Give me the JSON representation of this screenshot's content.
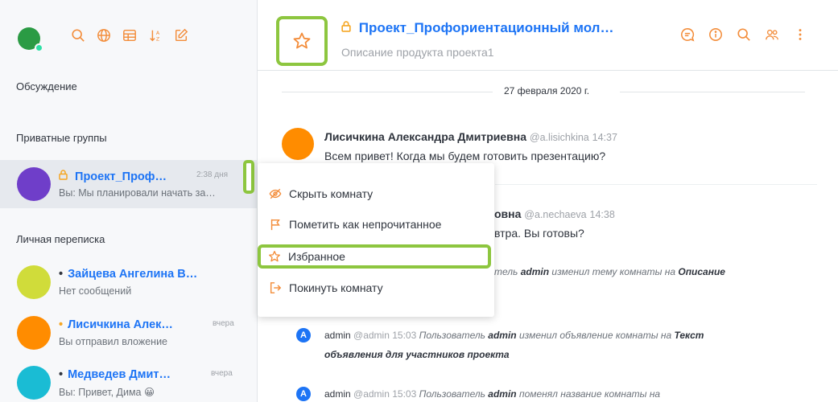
{
  "sidebar": {
    "sections": {
      "discussion": "Обсуждение",
      "private_groups": "Приватные группы",
      "direct": "Личная переписка"
    },
    "icons": [
      "search-icon",
      "globe-icon",
      "table-icon",
      "sort-icon",
      "edit-icon"
    ],
    "rooms": [
      {
        "prefix": "🔒",
        "name": "Проект_Проф…",
        "time": "2:38 дня",
        "last_message": "Вы: Мы планировали начать за…",
        "avatar_color": "#6f3ec9"
      },
      {
        "prefix": "•",
        "name": "Зайцева Ангелина В…",
        "time": "",
        "last_message": "Нет сообщений",
        "avatar_color": "#d0dc3a"
      },
      {
        "prefix": "•",
        "name": "Лисичкина Алек…",
        "time": "вчера",
        "last_message": "Вы отправил вложение",
        "avatar_color": "#ff8c00"
      },
      {
        "prefix": "•",
        "name": "Медведев Дмит…",
        "time": "вчера",
        "last_message": "Вы: Привет, Дима 😀",
        "avatar_color": "#1abcd4"
      }
    ]
  },
  "header": {
    "title": "Проект_Профориентационный мол…",
    "description": "Описание продукта проекта1",
    "icons": [
      "discussion-icon",
      "info-icon",
      "search-icon",
      "members-icon",
      "kebab-icon"
    ]
  },
  "main": {
    "date": "27 февраля 2020 г.",
    "messages": [
      {
        "author": "Лисичкина Александра Дмитриевна",
        "username": "@a.lisichkina",
        "time": "14:37",
        "text": "Всем привет! Когда мы будем готовить презентацию?",
        "avatar_color": "#ff8c00"
      },
      {
        "author_tail": "овна",
        "username": "@a.nechaeva",
        "time": "14:38",
        "text_tail": "втра. Вы готовы?"
      }
    ],
    "system_messages": [
      {
        "text_tail": "тель",
        "bold1": "admin",
        "mid": "изменил тему комнаты на",
        "bold2": "Описание"
      },
      {
        "author": "admin",
        "username": "@admin",
        "time": "15:03",
        "pre": "Пользователь",
        "bold1": "admin",
        "mid": "изменил объявление комнаты на",
        "bold2": "Текст",
        "line2": "объявления для участников проекта"
      },
      {
        "author": "admin",
        "username": "@admin",
        "time": "15:03",
        "pre": "Пользователь",
        "bold1": "admin",
        "mid": "поменял название комнаты на"
      }
    ]
  },
  "context_menu": {
    "items": [
      {
        "label": "Скрыть комнату",
        "icon": "eye-off-icon"
      },
      {
        "label": "Пометить как непрочитанное",
        "icon": "flag-icon"
      },
      {
        "label": "Избранное",
        "icon": "star-icon"
      },
      {
        "label": "Покинуть комнату",
        "icon": "leave-icon"
      }
    ]
  },
  "colors": {
    "accent": "#f38c39",
    "link": "#1d74f5",
    "highlight": "#8dc63f"
  }
}
